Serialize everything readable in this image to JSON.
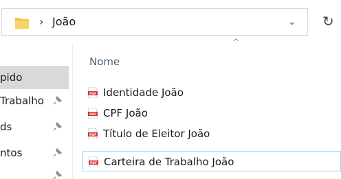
{
  "address_bar": {
    "folder_icon": "folder-icon",
    "separator": "›",
    "current_folder": "João",
    "dropdown_glyph": "⌄",
    "refresh_glyph": "↻"
  },
  "nav_pane": {
    "items": [
      {
        "label": "pido",
        "pinned": false,
        "state": "quick-access-highlight"
      },
      {
        "label": "Trabalho",
        "pinned": true,
        "state": "normal"
      },
      {
        "label": "ds",
        "pinned": true,
        "state": "normal"
      },
      {
        "label": "ntos",
        "pinned": true,
        "state": "normal"
      },
      {
        "label": "",
        "pinned": true,
        "state": "normal"
      }
    ],
    "pin_glyph": "📌"
  },
  "file_list": {
    "column_header": "Nome",
    "sort_glyph": "^",
    "files": [
      {
        "name": "Identidade João",
        "type": "PDF",
        "selected": false
      },
      {
        "name": "CPF João",
        "type": "PDF",
        "selected": false
      },
      {
        "name": "Título de Eleitor João",
        "type": "PDF",
        "selected": false
      },
      {
        "name": "Carteira de Trabalho João",
        "type": "PDF",
        "selected": true
      }
    ]
  },
  "colors": {
    "selection_border": "#99d1ff",
    "quick_access_bg": "#d9d9d9",
    "header_text": "#4c607a",
    "pdf_red": "#d9312b",
    "folder_yellow": "#f6c445"
  }
}
